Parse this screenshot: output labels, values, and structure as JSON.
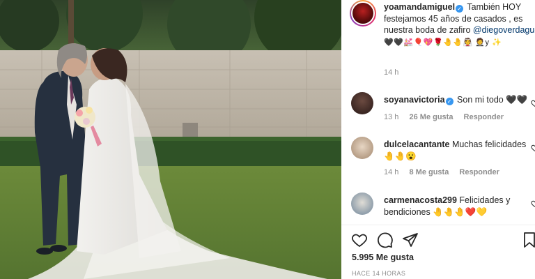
{
  "post": {
    "author": "yoamandamiguel",
    "caption": "También HOY festejamos 45 años de casados , es nuestra boda de zafiro",
    "mention": "@diegoverdaguer",
    "emojis_line1": "🖤🖤💒🎈💖🌹🤚🤚👰",
    "emojis_line2": "🤵y ✨",
    "time": "14 h"
  },
  "comments": [
    {
      "user": "soyanavictoria",
      "verified": true,
      "text": "Son mi todo 🖤🖤",
      "time": "13 h",
      "likes": "26 Me gusta",
      "reply": "Responder",
      "avatar_color": "#3a2622"
    },
    {
      "user": "dulcelacantante",
      "verified": false,
      "text": "Muchas felicidades🤚🤚😮",
      "time": "14 h",
      "likes": "8 Me gusta",
      "reply": "Responder",
      "avatar_color": "#d9c6b0"
    },
    {
      "user": "carmenacosta299",
      "verified": false,
      "text": "Felicidades y bendiciones 🤚🤚🤚❤️💛",
      "avatar_color": "#a7b5c2"
    }
  ],
  "footer": {
    "likes": "5.995 Me gusta",
    "date": "HACE 14 HORAS"
  },
  "icons": [
    "heart-icon",
    "comment-icon",
    "share-icon",
    "bookmark-icon",
    "verified-badge-icon"
  ],
  "colors": {
    "verified": "#3897f0",
    "mention": "#00376b",
    "muted": "#8e8e8e"
  }
}
